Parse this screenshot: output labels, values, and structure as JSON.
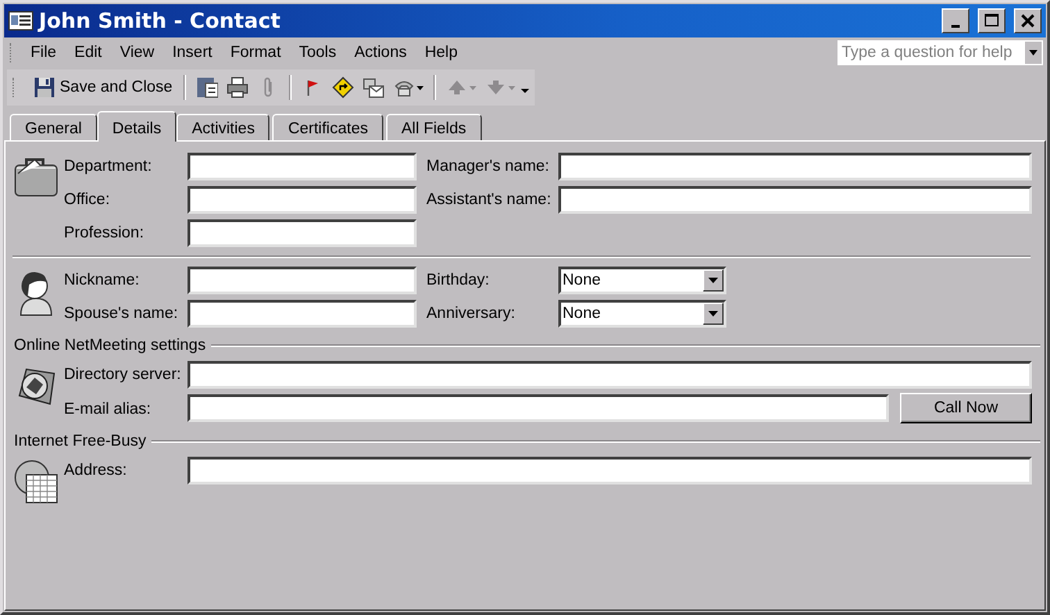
{
  "window": {
    "title": "John Smith - Contact"
  },
  "menu": [
    "File",
    "Edit",
    "View",
    "Insert",
    "Format",
    "Tools",
    "Actions",
    "Help"
  ],
  "help_box": {
    "placeholder": "Type a question for help"
  },
  "toolbar": {
    "save_button": "Save and Close",
    "tools": [
      {
        "disabled": false
      },
      {
        "disabled": false
      },
      {
        "disabled": true
      },
      {
        "disabled": false
      },
      {
        "disabled": false
      },
      {
        "disabled": false
      },
      {
        "disabled": false
      },
      {
        "disabled": true
      },
      {
        "disabled": true
      }
    ]
  },
  "tabs": [
    {
      "label": "General",
      "selected": false
    },
    {
      "label": "Details",
      "selected": true
    },
    {
      "label": "Activities",
      "selected": false
    },
    {
      "label": "Certificates",
      "selected": false
    },
    {
      "label": "All Fields",
      "selected": false
    }
  ],
  "sections": [
    {
      "rows": [
        [
          {
            "label": "Department:",
            "kind": "text"
          },
          {
            "label": "Manager's name:",
            "kind": "text"
          }
        ],
        [
          {
            "label": "Office:",
            "kind": "text"
          },
          {
            "label": "Assistant's name:",
            "kind": "text"
          }
        ],
        [
          {
            "label": "Profession:",
            "kind": "text"
          }
        ]
      ]
    },
    {
      "rows": [
        [
          {
            "label": "Nickname:",
            "kind": "text"
          },
          {
            "label": "Birthday:",
            "kind": "dropdown",
            "value": "None"
          }
        ],
        [
          {
            "label": "Spouse's name:",
            "kind": "text"
          },
          {
            "label": "Anniversary:",
            "kind": "dropdown",
            "value": "None"
          }
        ]
      ]
    },
    {
      "heading": "Online NetMeeting settings",
      "rows": [
        [
          {
            "label": "Directory server:",
            "kind": "wide"
          }
        ],
        [
          {
            "label": "E-mail alias:",
            "kind": "wide",
            "button": "Call Now"
          }
        ]
      ]
    },
    {
      "heading": "Internet Free-Busy",
      "rows": [
        [
          {
            "label": "Address:",
            "kind": "wide"
          }
        ]
      ]
    }
  ]
}
